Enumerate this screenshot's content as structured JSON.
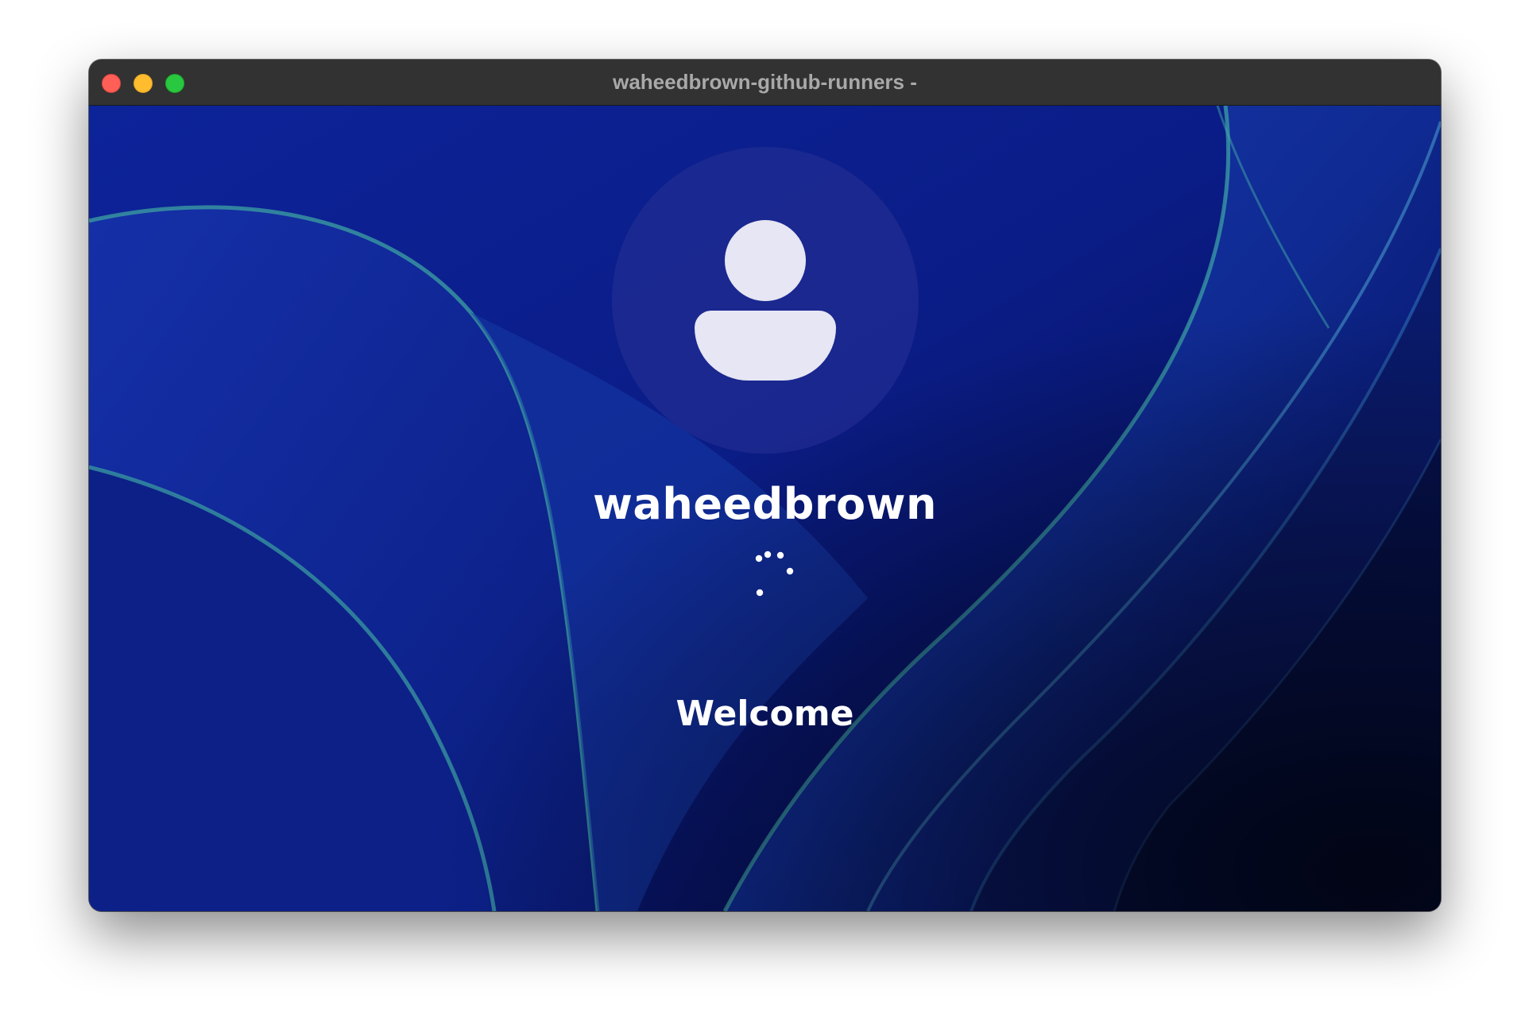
{
  "window": {
    "title": "waheedbrown-github-runners -"
  },
  "traffic_lights": {
    "close_color": "#ff5f57",
    "minimize_color": "#febc2e",
    "zoom_color": "#28c840"
  },
  "login": {
    "username": "waheedbrown",
    "status": "Welcome",
    "avatar_icon": "user-silhouette-icon",
    "spinner_icon": "loading-spinner-icon"
  },
  "colors": {
    "background_primary": "#0b1d8a",
    "background_dark": "#050a3a",
    "accent_teal": "#3fa8a8",
    "text": "#ffffff"
  }
}
